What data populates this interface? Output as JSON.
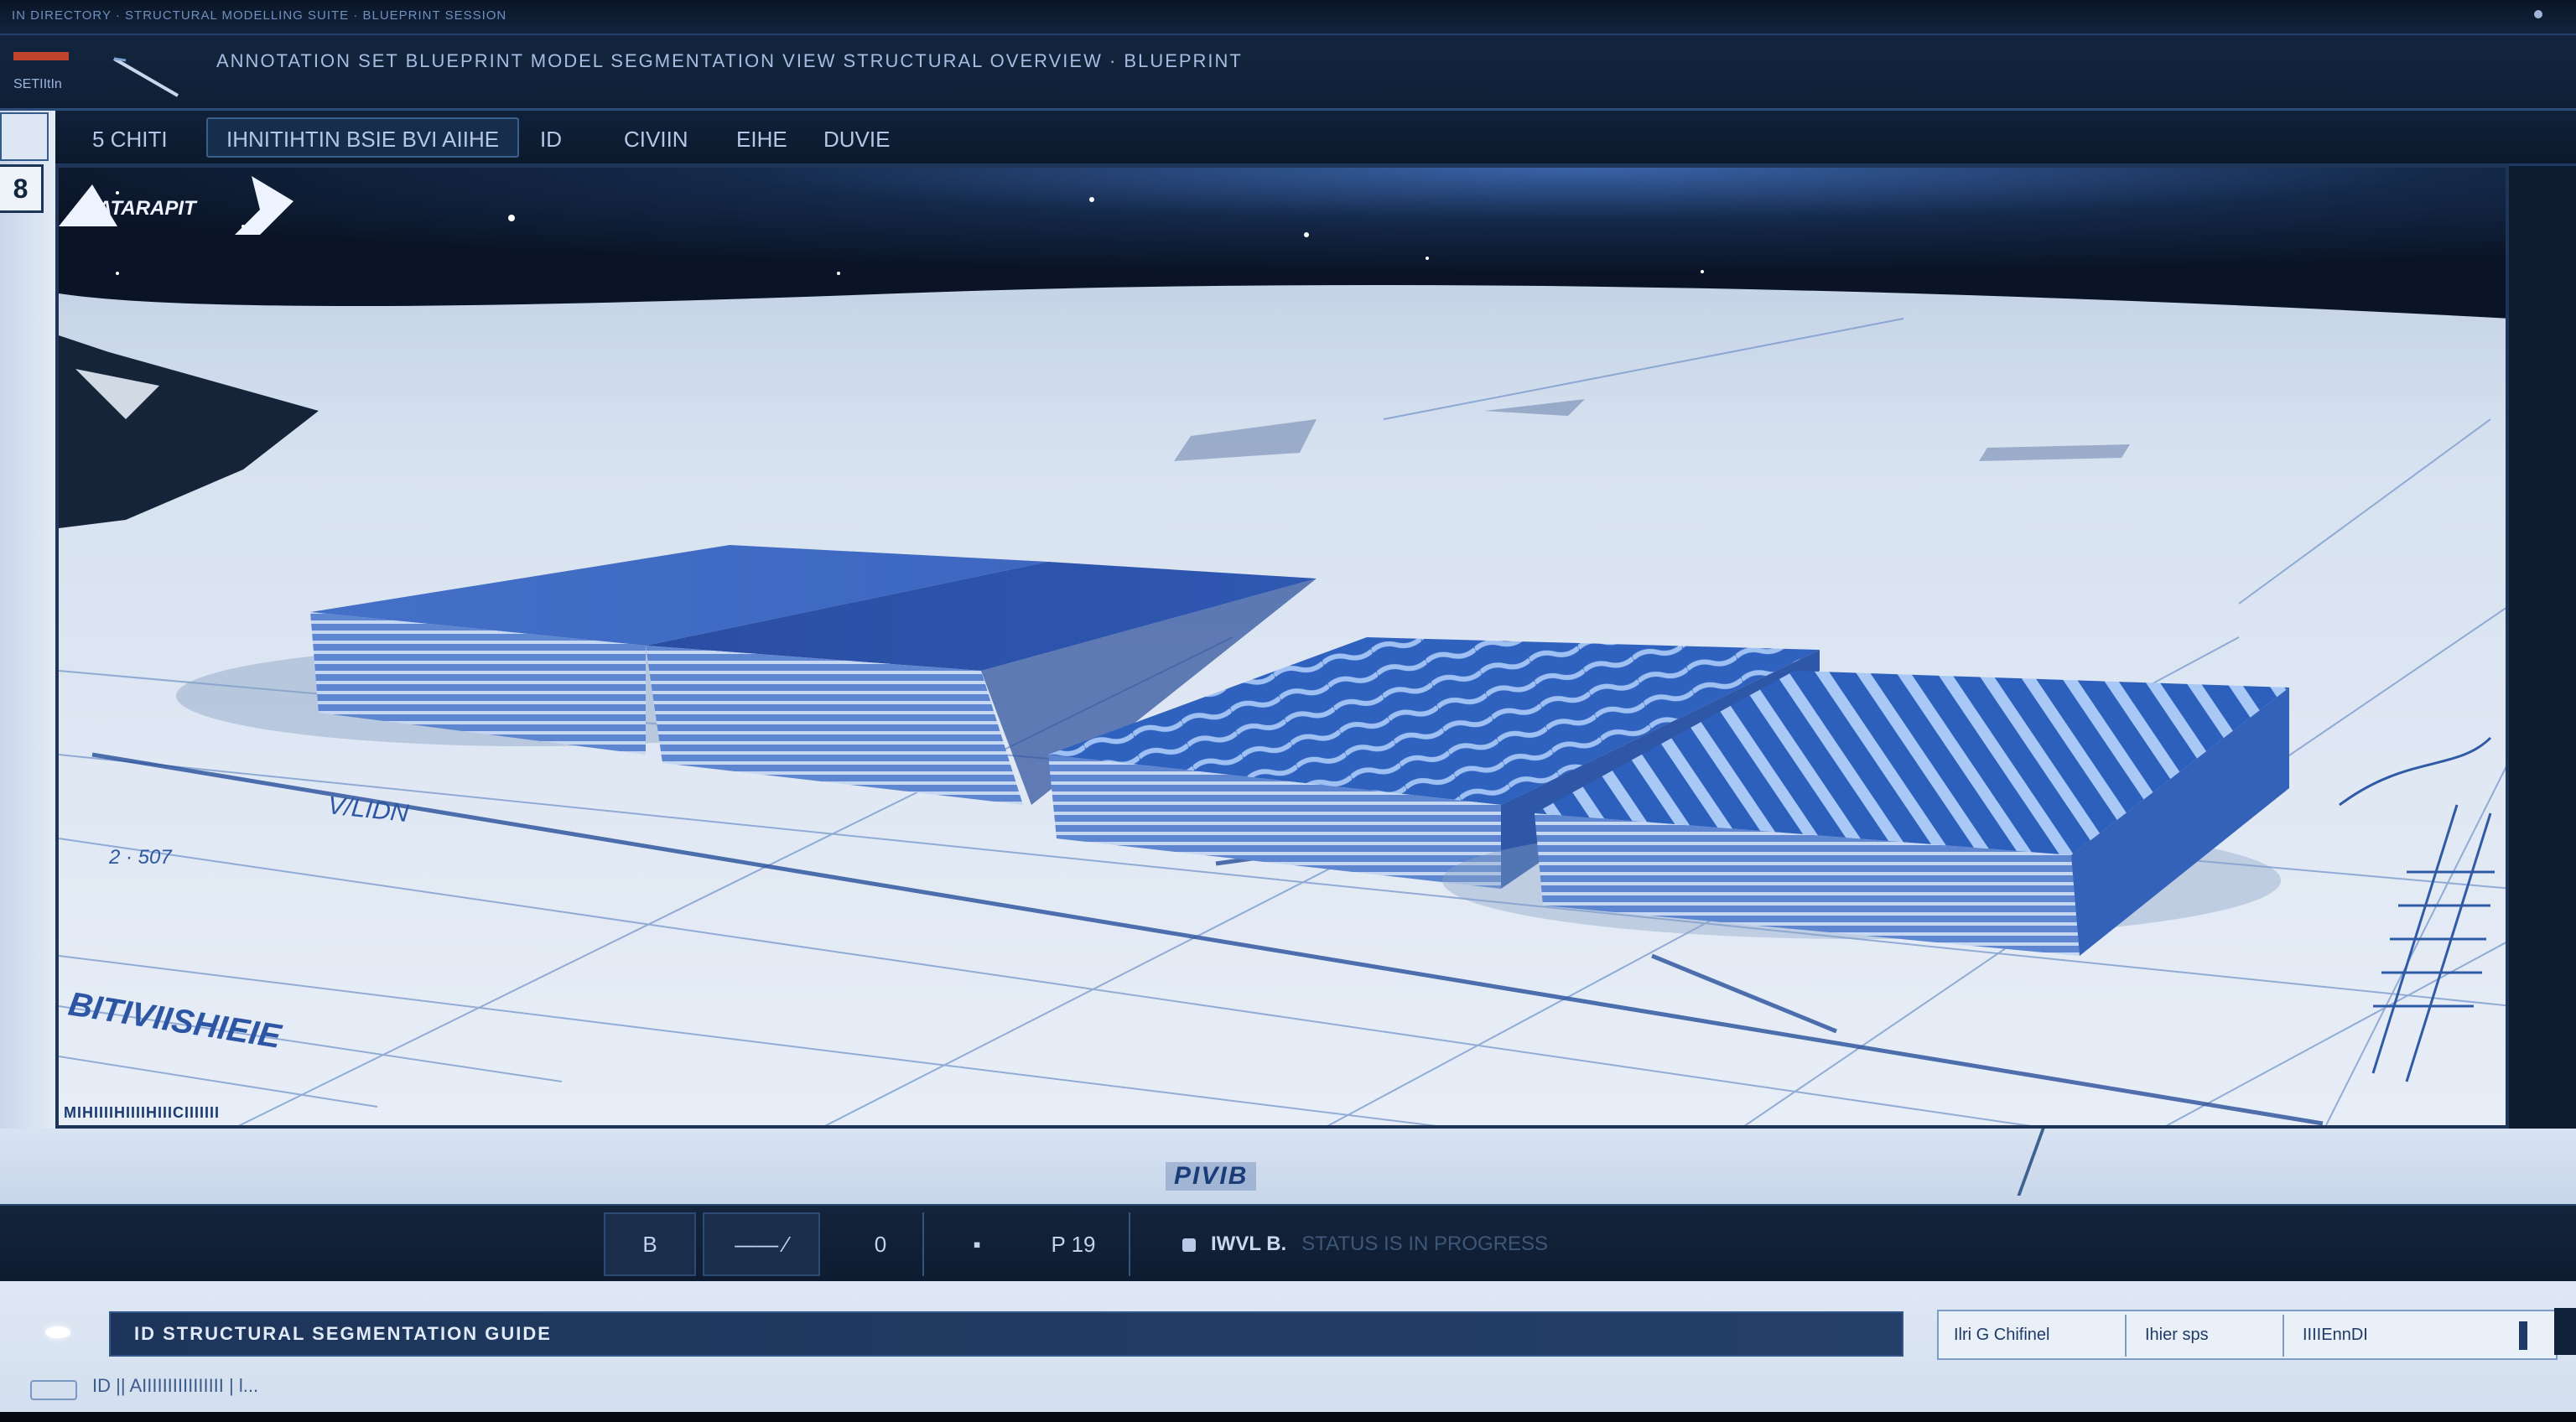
{
  "top_strip": {
    "crumb": "IN DIRECTORY · STRUCTURAL MODELLING SUITE · BLUEPRINT SESSION"
  },
  "title_bar": {
    "app_name": "SETIItIn",
    "title": "ANNOTATION SET BLUEPRINT MODEL SEGMENTATION VIEW STRUCTURAL OVERVIEW · BLUEPRINT"
  },
  "tabs": [
    {
      "label": "5 CHITI",
      "active": false
    },
    {
      "label": "IHNITIHTIN BSIE BVI AIIHE",
      "active": true
    },
    {
      "label": "ID",
      "active": false
    },
    {
      "label": "CIVIIN",
      "active": false
    },
    {
      "label": "EIHE",
      "active": false
    },
    {
      "label": "DUVIE",
      "active": false
    }
  ],
  "side_tab": {
    "label": "8"
  },
  "viewport": {
    "brand_text": "ATARAPIT",
    "floor_label_left": "V/LIDN",
    "floor_label_left2": "2 · 507",
    "floor_label_side": "BITIVIISHIEIE",
    "caption": "MIHIIIIHIIIIHIIICIIIIIII"
  },
  "under_label": "PIVIB",
  "toolbar": {
    "tools": [
      {
        "icon": "document-icon",
        "label": "B"
      },
      {
        "icon": "ruler-icon",
        "label": "—— ⁄"
      },
      {
        "icon": "zero-readout",
        "label": "0"
      },
      {
        "icon": "square-icon",
        "label": "▪"
      },
      {
        "icon": "page-icon",
        "label": "P  19"
      }
    ],
    "status": "IWVL B.",
    "status_ghost": "STATUS IS IN PROGRESS"
  },
  "status": {
    "banner": "ID  STRUCTURAL SEGMENTATION GUIDE",
    "fields": [
      "Ilri G  Chifinel",
      "Ihier sps",
      "IIIIEnnDI"
    ]
  },
  "footer": {
    "text": "ID  ||  AIIIIIIIIIIIIIIII  |  l..."
  },
  "colors": {
    "app_dark": "#0d1b2f",
    "accent_blue": "#3d6fd0",
    "paper": "#dfe8f4",
    "brand_red": "#c0442c"
  }
}
